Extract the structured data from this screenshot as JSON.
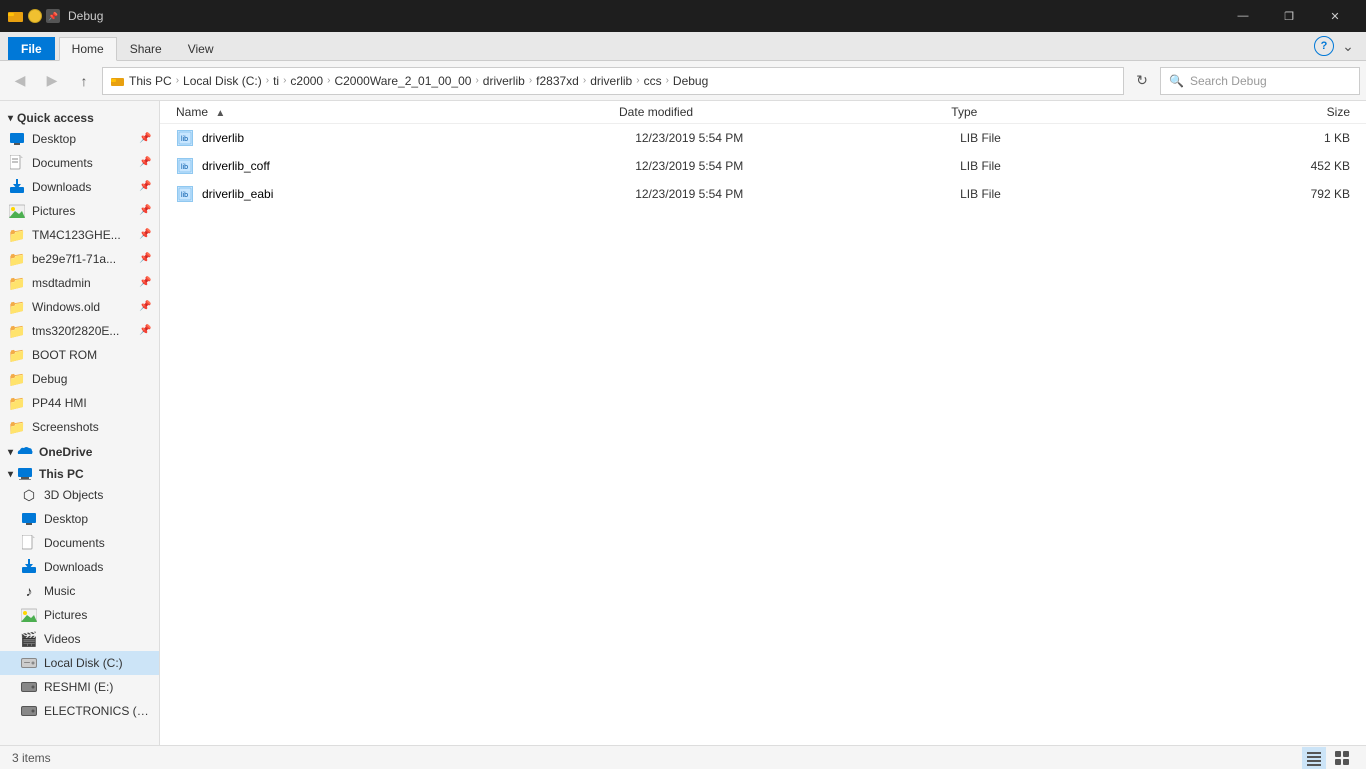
{
  "titleBar": {
    "title": "Debug",
    "appIcon": "folder-app-icon",
    "controls": {
      "minimize": "—",
      "maximize": "❐",
      "close": "✕"
    }
  },
  "ribbon": {
    "tabs": [
      {
        "label": "File",
        "active": false,
        "special": true
      },
      {
        "label": "Home",
        "active": true
      },
      {
        "label": "Share",
        "active": false
      },
      {
        "label": "View",
        "active": false
      }
    ],
    "helpBtn": "?"
  },
  "addressBar": {
    "backDisabled": false,
    "forwardDisabled": true,
    "upDisabled": false,
    "path": [
      {
        "label": "This PC"
      },
      {
        "label": "Local Disk (C:)"
      },
      {
        "label": "ti"
      },
      {
        "label": "c2000"
      },
      {
        "label": "C2000Ware_2_01_00_00"
      },
      {
        "label": "driverlib"
      },
      {
        "label": "f2837xd"
      },
      {
        "label": "driverlib"
      },
      {
        "label": "ccs"
      },
      {
        "label": "Debug"
      }
    ],
    "searchPlaceholder": "Search Debug"
  },
  "sidebar": {
    "quickAccess": {
      "label": "Quick access",
      "items": [
        {
          "label": "Desktop",
          "pinned": true,
          "type": "desktop"
        },
        {
          "label": "Documents",
          "pinned": true,
          "type": "documents"
        },
        {
          "label": "Downloads",
          "pinned": true,
          "type": "downloads"
        },
        {
          "label": "Pictures",
          "pinned": true,
          "type": "pictures"
        },
        {
          "label": "TM4C123GHE...",
          "pinned": true,
          "type": "folder"
        },
        {
          "label": "be29e7f1-71a...",
          "pinned": true,
          "type": "folder"
        },
        {
          "label": "msdtadmin",
          "pinned": true,
          "type": "folder"
        },
        {
          "label": "Windows.old",
          "pinned": true,
          "type": "folder"
        },
        {
          "label": "tms320f2820E...",
          "pinned": true,
          "type": "folder"
        },
        {
          "label": "BOOT ROM",
          "type": "folder"
        },
        {
          "label": "Debug",
          "type": "folder"
        },
        {
          "label": "PP44 HMI",
          "type": "folder"
        },
        {
          "label": "Screenshots",
          "type": "folder"
        }
      ]
    },
    "oneDrive": {
      "label": "OneDrive",
      "type": "onedrive"
    },
    "thisPC": {
      "label": "This PC",
      "items": [
        {
          "label": "3D Objects",
          "type": "3dobjects"
        },
        {
          "label": "Desktop",
          "type": "desktop"
        },
        {
          "label": "Documents",
          "type": "documents"
        },
        {
          "label": "Downloads",
          "type": "downloads"
        },
        {
          "label": "Music",
          "type": "music"
        },
        {
          "label": "Pictures",
          "type": "pictures"
        },
        {
          "label": "Videos",
          "type": "videos"
        },
        {
          "label": "Local Disk (C:)",
          "type": "drive",
          "active": true
        },
        {
          "label": "RESHMI (E:)",
          "type": "drive"
        },
        {
          "label": "ELECTRONICS (F:)",
          "type": "drive"
        }
      ]
    }
  },
  "content": {
    "columns": {
      "name": "Name",
      "dateModified": "Date modified",
      "type": "Type",
      "size": "Size"
    },
    "files": [
      {
        "name": "driverlib",
        "dateModified": "12/23/2019 5:54 PM",
        "type": "LIB File",
        "size": "1 KB"
      },
      {
        "name": "driverlib_coff",
        "dateModified": "12/23/2019 5:54 PM",
        "type": "LIB File",
        "size": "452 KB"
      },
      {
        "name": "driverlib_eabi",
        "dateModified": "12/23/2019 5:54 PM",
        "type": "LIB File",
        "size": "792 KB"
      }
    ]
  },
  "statusBar": {
    "itemCount": "3 items",
    "viewIcons": {
      "details": "≡",
      "largeIcons": "⊞"
    }
  }
}
